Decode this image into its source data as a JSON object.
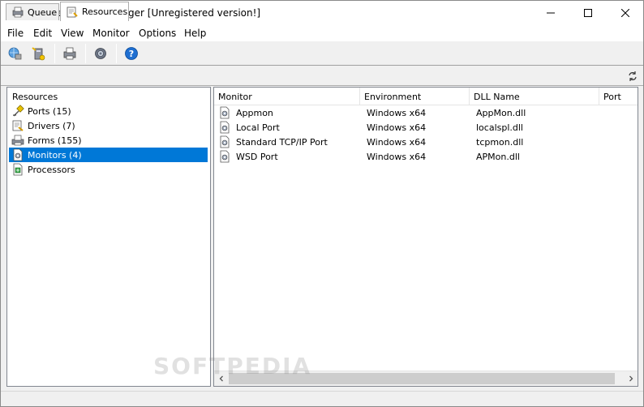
{
  "window": {
    "title": "Remote Queue Manager [Unregistered version!]"
  },
  "menu": [
    "File",
    "Edit",
    "View",
    "Monitor",
    "Options",
    "Help"
  ],
  "toolbar": {
    "buttons": [
      "connect-server-icon",
      "add-printer-icon",
      "print-icon",
      "settings-gear-icon",
      "help-icon"
    ]
  },
  "tabs": [
    {
      "label": "Queue",
      "active": false
    },
    {
      "label": "Resources",
      "active": true
    }
  ],
  "tree": {
    "root": "Resources",
    "items": [
      {
        "label": "Ports (15)",
        "icon": "port-icon",
        "selected": false
      },
      {
        "label": "Drivers (7)",
        "icon": "driver-icon",
        "selected": false
      },
      {
        "label": "Forms (155)",
        "icon": "forms-icon",
        "selected": false
      },
      {
        "label": "Monitors (4)",
        "icon": "monitor-icon",
        "selected": true
      },
      {
        "label": "Processors",
        "icon": "processor-icon",
        "selected": false
      }
    ]
  },
  "table": {
    "columns": [
      "Monitor",
      "Environment",
      "DLL Name",
      "Port"
    ],
    "rows": [
      {
        "monitor": "Appmon",
        "environment": "Windows x64",
        "dll": "AppMon.dll"
      },
      {
        "monitor": "Local Port",
        "environment": "Windows x64",
        "dll": "localspl.dll"
      },
      {
        "monitor": "Standard TCP/IP Port",
        "environment": "Windows x64",
        "dll": "tcpmon.dll"
      },
      {
        "monitor": "WSD Port",
        "environment": "Windows x64",
        "dll": "APMon.dll"
      }
    ]
  },
  "watermark": "SOFTPEDIA",
  "colors": {
    "selection": "#0078d7",
    "background": "#f0f0f0"
  }
}
